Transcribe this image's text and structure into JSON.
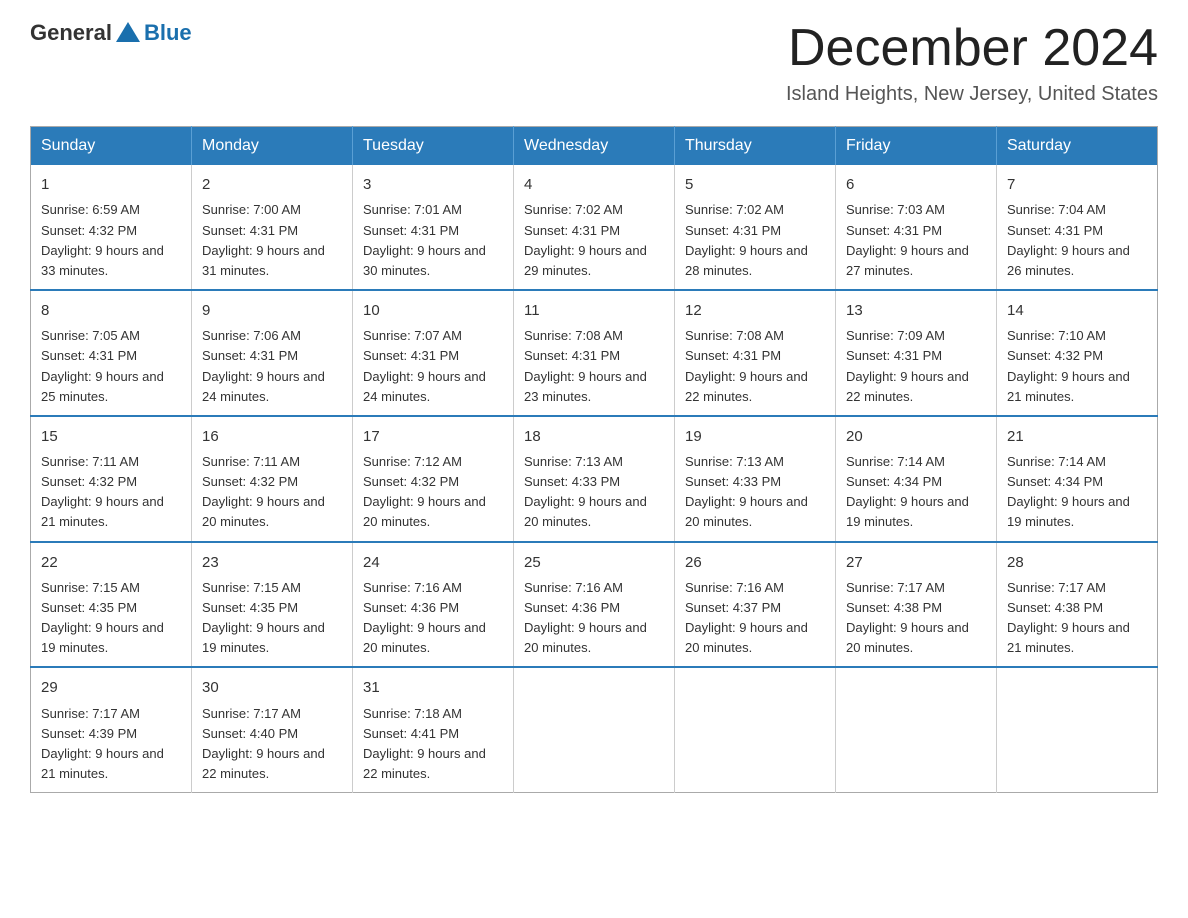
{
  "logo": {
    "general": "General",
    "blue": "Blue"
  },
  "header": {
    "month_year": "December 2024",
    "location": "Island Heights, New Jersey, United States"
  },
  "weekdays": [
    "Sunday",
    "Monday",
    "Tuesday",
    "Wednesday",
    "Thursday",
    "Friday",
    "Saturday"
  ],
  "weeks": [
    [
      {
        "day": "1",
        "sunrise": "6:59 AM",
        "sunset": "4:32 PM",
        "daylight": "9 hours and 33 minutes."
      },
      {
        "day": "2",
        "sunrise": "7:00 AM",
        "sunset": "4:31 PM",
        "daylight": "9 hours and 31 minutes."
      },
      {
        "day": "3",
        "sunrise": "7:01 AM",
        "sunset": "4:31 PM",
        "daylight": "9 hours and 30 minutes."
      },
      {
        "day": "4",
        "sunrise": "7:02 AM",
        "sunset": "4:31 PM",
        "daylight": "9 hours and 29 minutes."
      },
      {
        "day": "5",
        "sunrise": "7:02 AM",
        "sunset": "4:31 PM",
        "daylight": "9 hours and 28 minutes."
      },
      {
        "day": "6",
        "sunrise": "7:03 AM",
        "sunset": "4:31 PM",
        "daylight": "9 hours and 27 minutes."
      },
      {
        "day": "7",
        "sunrise": "7:04 AM",
        "sunset": "4:31 PM",
        "daylight": "9 hours and 26 minutes."
      }
    ],
    [
      {
        "day": "8",
        "sunrise": "7:05 AM",
        "sunset": "4:31 PM",
        "daylight": "9 hours and 25 minutes."
      },
      {
        "day": "9",
        "sunrise": "7:06 AM",
        "sunset": "4:31 PM",
        "daylight": "9 hours and 24 minutes."
      },
      {
        "day": "10",
        "sunrise": "7:07 AM",
        "sunset": "4:31 PM",
        "daylight": "9 hours and 24 minutes."
      },
      {
        "day": "11",
        "sunrise": "7:08 AM",
        "sunset": "4:31 PM",
        "daylight": "9 hours and 23 minutes."
      },
      {
        "day": "12",
        "sunrise": "7:08 AM",
        "sunset": "4:31 PM",
        "daylight": "9 hours and 22 minutes."
      },
      {
        "day": "13",
        "sunrise": "7:09 AM",
        "sunset": "4:31 PM",
        "daylight": "9 hours and 22 minutes."
      },
      {
        "day": "14",
        "sunrise": "7:10 AM",
        "sunset": "4:32 PM",
        "daylight": "9 hours and 21 minutes."
      }
    ],
    [
      {
        "day": "15",
        "sunrise": "7:11 AM",
        "sunset": "4:32 PM",
        "daylight": "9 hours and 21 minutes."
      },
      {
        "day": "16",
        "sunrise": "7:11 AM",
        "sunset": "4:32 PM",
        "daylight": "9 hours and 20 minutes."
      },
      {
        "day": "17",
        "sunrise": "7:12 AM",
        "sunset": "4:32 PM",
        "daylight": "9 hours and 20 minutes."
      },
      {
        "day": "18",
        "sunrise": "7:13 AM",
        "sunset": "4:33 PM",
        "daylight": "9 hours and 20 minutes."
      },
      {
        "day": "19",
        "sunrise": "7:13 AM",
        "sunset": "4:33 PM",
        "daylight": "9 hours and 20 minutes."
      },
      {
        "day": "20",
        "sunrise": "7:14 AM",
        "sunset": "4:34 PM",
        "daylight": "9 hours and 19 minutes."
      },
      {
        "day": "21",
        "sunrise": "7:14 AM",
        "sunset": "4:34 PM",
        "daylight": "9 hours and 19 minutes."
      }
    ],
    [
      {
        "day": "22",
        "sunrise": "7:15 AM",
        "sunset": "4:35 PM",
        "daylight": "9 hours and 19 minutes."
      },
      {
        "day": "23",
        "sunrise": "7:15 AM",
        "sunset": "4:35 PM",
        "daylight": "9 hours and 19 minutes."
      },
      {
        "day": "24",
        "sunrise": "7:16 AM",
        "sunset": "4:36 PM",
        "daylight": "9 hours and 20 minutes."
      },
      {
        "day": "25",
        "sunrise": "7:16 AM",
        "sunset": "4:36 PM",
        "daylight": "9 hours and 20 minutes."
      },
      {
        "day": "26",
        "sunrise": "7:16 AM",
        "sunset": "4:37 PM",
        "daylight": "9 hours and 20 minutes."
      },
      {
        "day": "27",
        "sunrise": "7:17 AM",
        "sunset": "4:38 PM",
        "daylight": "9 hours and 20 minutes."
      },
      {
        "day": "28",
        "sunrise": "7:17 AM",
        "sunset": "4:38 PM",
        "daylight": "9 hours and 21 minutes."
      }
    ],
    [
      {
        "day": "29",
        "sunrise": "7:17 AM",
        "sunset": "4:39 PM",
        "daylight": "9 hours and 21 minutes."
      },
      {
        "day": "30",
        "sunrise": "7:17 AM",
        "sunset": "4:40 PM",
        "daylight": "9 hours and 22 minutes."
      },
      {
        "day": "31",
        "sunrise": "7:18 AM",
        "sunset": "4:41 PM",
        "daylight": "9 hours and 22 minutes."
      },
      null,
      null,
      null,
      null
    ]
  ],
  "labels": {
    "sunrise": "Sunrise:",
    "sunset": "Sunset:",
    "daylight": "Daylight:"
  }
}
